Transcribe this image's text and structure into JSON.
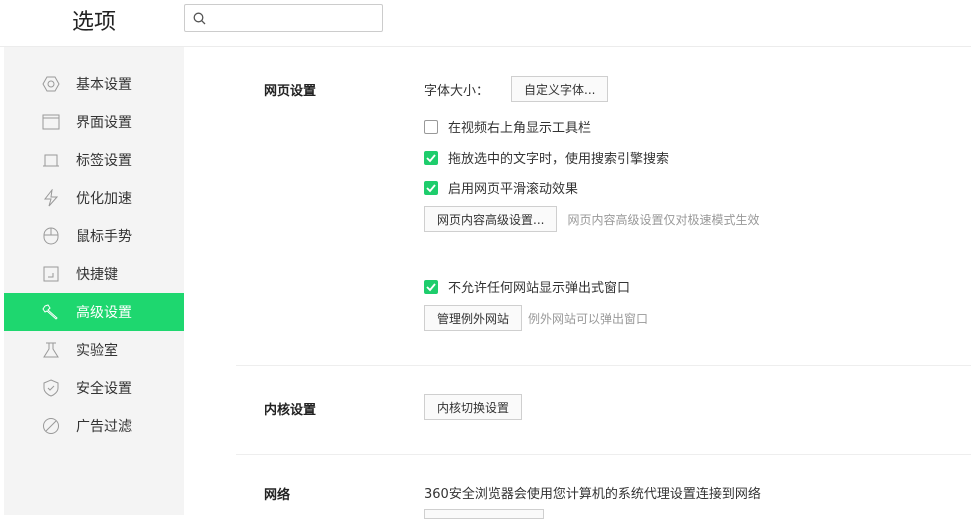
{
  "header": {
    "title": "选项",
    "search_placeholder": ""
  },
  "sidebar": {
    "items": [
      {
        "label": "基本设置",
        "icon": "hexagon-gear-icon"
      },
      {
        "label": "界面设置",
        "icon": "window-icon"
      },
      {
        "label": "标签设置",
        "icon": "tab-icon"
      },
      {
        "label": "优化加速",
        "icon": "lightning-icon"
      },
      {
        "label": "鼠标手势",
        "icon": "mouse-icon"
      },
      {
        "label": "快捷键",
        "icon": "keyboard-icon"
      },
      {
        "label": "高级设置",
        "icon": "wrench-icon",
        "active": true
      },
      {
        "label": "实验室",
        "icon": "flask-icon"
      },
      {
        "label": "安全设置",
        "icon": "shield-icon"
      },
      {
        "label": "广告过滤",
        "icon": "block-icon"
      }
    ]
  },
  "web": {
    "title": "网页设置",
    "font_size_label": "字体大小：",
    "custom_font_button": "自定义字体...",
    "options": [
      {
        "label": "在视频右上角显示工具栏",
        "checked": false
      },
      {
        "label": "拖放选中的文字时，使用搜索引擎搜索",
        "checked": true
      },
      {
        "label": "启用网页平滑滚动效果",
        "checked": true
      }
    ],
    "advanced_button": "网页内容高级设置...",
    "advanced_hint": "网页内容高级设置仅对极速模式生效",
    "popup_option": {
      "label": "不允许任何网站显示弹出式窗口",
      "checked": true
    },
    "exceptions_button": "管理例外网站",
    "exceptions_hint": "例外网站可以弹出窗口"
  },
  "kernel": {
    "title": "内核设置",
    "switch_button": "内核切换设置"
  },
  "network": {
    "title": "网络",
    "description": "360安全浏览器会使用您计算机的系统代理设置连接到网络"
  },
  "colors": {
    "accent": "#1ed76f",
    "sidebar_bg": "#f4f4f4"
  }
}
